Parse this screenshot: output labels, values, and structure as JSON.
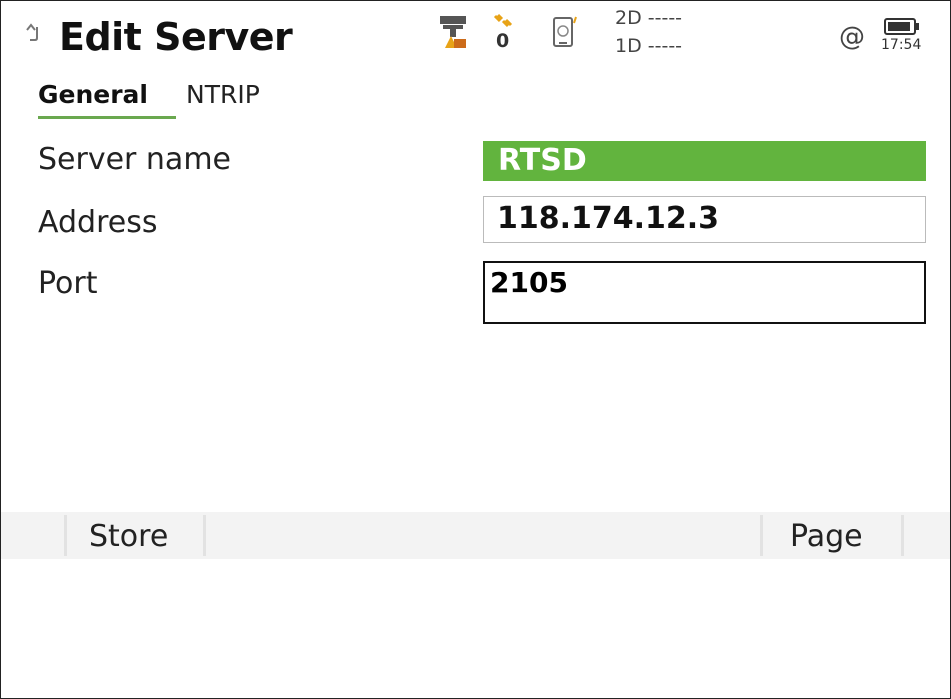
{
  "header": {
    "title": "Edit Server",
    "satellite_count": "0",
    "quality_2d": "2D -----",
    "quality_1d": "1D -----",
    "connection_symbol": "@",
    "clock": "17:54",
    "icons": [
      "back-arrow-icon",
      "gnss-antenna-icon",
      "satellite-icon",
      "device-icon",
      "battery-icon"
    ]
  },
  "tabs": [
    {
      "label": "General",
      "active": true
    },
    {
      "label": "NTRIP",
      "active": false
    }
  ],
  "form": {
    "server_name": {
      "label": "Server name",
      "value": "RTSD"
    },
    "address": {
      "label": "Address",
      "value": "118.174.12.3"
    },
    "port": {
      "label": "Port",
      "value": "2105"
    }
  },
  "toolbar": {
    "store_label": "Store",
    "page_label": "Page"
  },
  "colors": {
    "accent_green": "#62b43e",
    "tab_underline": "#6aa84f",
    "antenna_warning": "#e8a317",
    "satellite_accent": "#e8a317"
  }
}
